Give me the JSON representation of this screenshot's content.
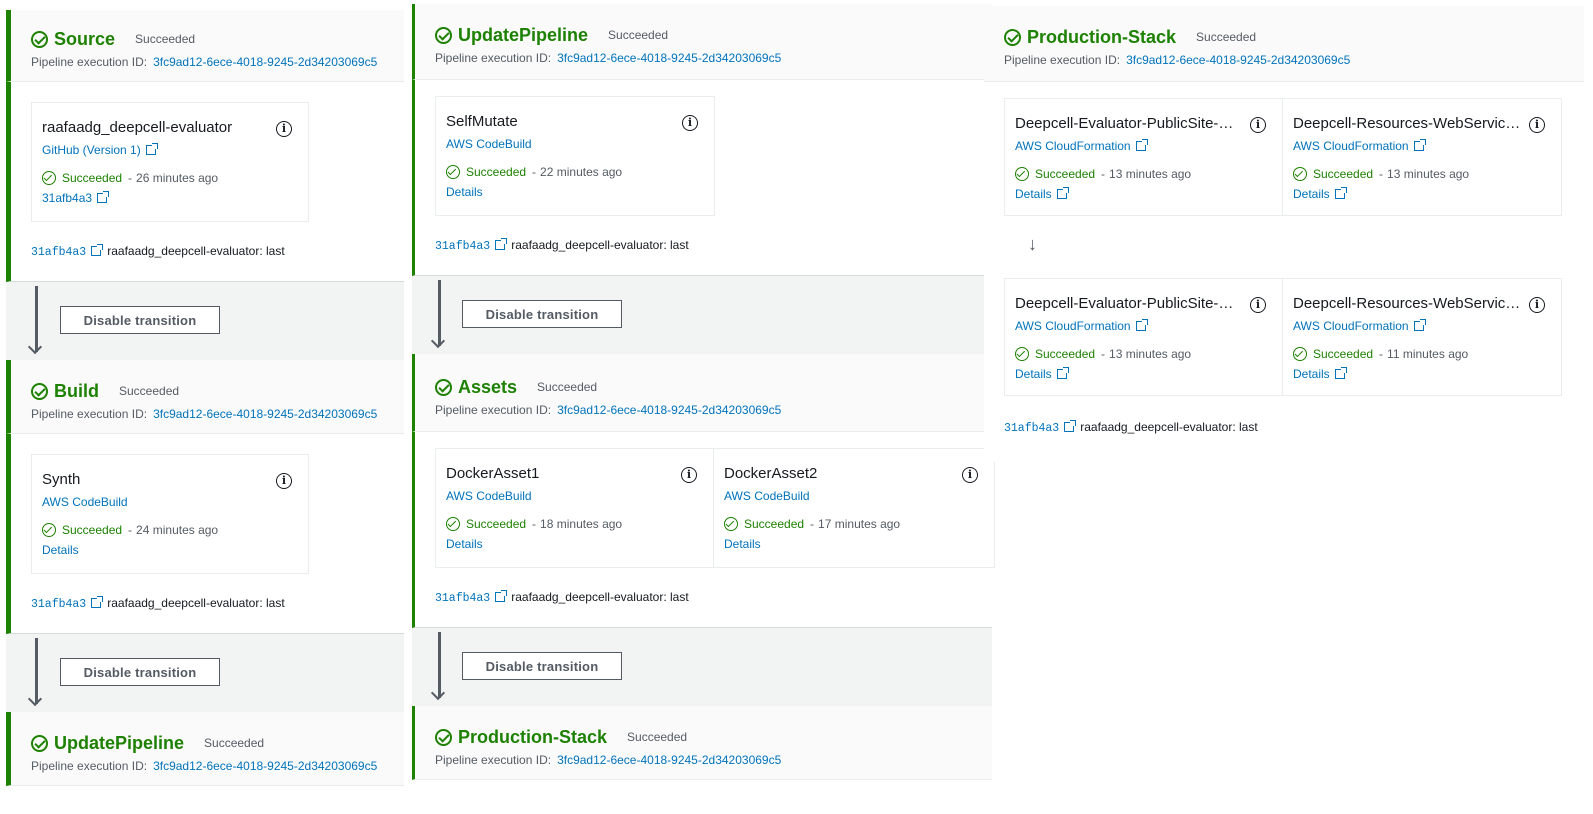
{
  "stage_status": "Succeeded",
  "execution_label": "Pipeline execution ID:",
  "execution_id": "3fc9ad12-6ece-4018-9245-2d34203069c5",
  "revision": {
    "commit": "31afb4a3",
    "message": "raafaadg_deepcell-evaluator: last"
  },
  "transition_button": "Disable transition",
  "stages": {
    "source": "Source",
    "build": "Build",
    "update_pipeline": "UpdatePipeline",
    "assets": "Assets",
    "production_stack": "Production-Stack"
  },
  "actions": {
    "source": {
      "name": "raafaadg_deepcell-evaluator",
      "provider": "GitHub (Version 1)",
      "status": "Succeeded",
      "time": "26 minutes ago",
      "extra": "31afb4a3"
    },
    "synth": {
      "name": "Synth",
      "provider": "AWS CodeBuild",
      "status": "Succeeded",
      "time": "24 minutes ago",
      "details": "Details"
    },
    "self_mutate": {
      "name": "SelfMutate",
      "provider": "AWS CodeBuild",
      "status": "Succeeded",
      "time": "22 minutes ago",
      "details": "Details"
    },
    "docker_asset1": {
      "name": "DockerAsset1",
      "provider": "AWS CodeBuild",
      "status": "Succeeded",
      "time": "18 minutes ago",
      "details": "Details"
    },
    "docker_asset2": {
      "name": "DockerAsset2",
      "provider": "AWS CodeBuild",
      "status": "Succeeded",
      "time": "17 minutes ago",
      "details": "Details"
    },
    "prod_1a": {
      "name": "Deepcell-Evaluator-PublicSite-…",
      "provider": "AWS CloudFormation",
      "status": "Succeeded",
      "time": "13 minutes ago",
      "details": "Details"
    },
    "prod_1b": {
      "name": "Deepcell-Resources-WebServic…",
      "provider": "AWS CloudFormation",
      "status": "Succeeded",
      "time": "13 minutes ago",
      "details": "Details"
    },
    "prod_2a": {
      "name": "Deepcell-Evaluator-PublicSite-…",
      "provider": "AWS CloudFormation",
      "status": "Succeeded",
      "time": "13 minutes ago",
      "details": "Details"
    },
    "prod_2b": {
      "name": "Deepcell-Resources-WebServic…",
      "provider": "AWS CloudFormation",
      "status": "Succeeded",
      "time": "11 minutes ago",
      "details": "Details"
    }
  },
  "icons": {
    "status": "check-circle-icon",
    "external": "external-link-icon",
    "info": "info-icon",
    "arrow": "arrow-down-icon"
  },
  "colors": {
    "success": "#1d8102",
    "link": "#0073bb",
    "text": "#16191f",
    "muted": "#545b64",
    "header_bg": "#fafafa",
    "transition_bg": "#f2f3f3"
  }
}
